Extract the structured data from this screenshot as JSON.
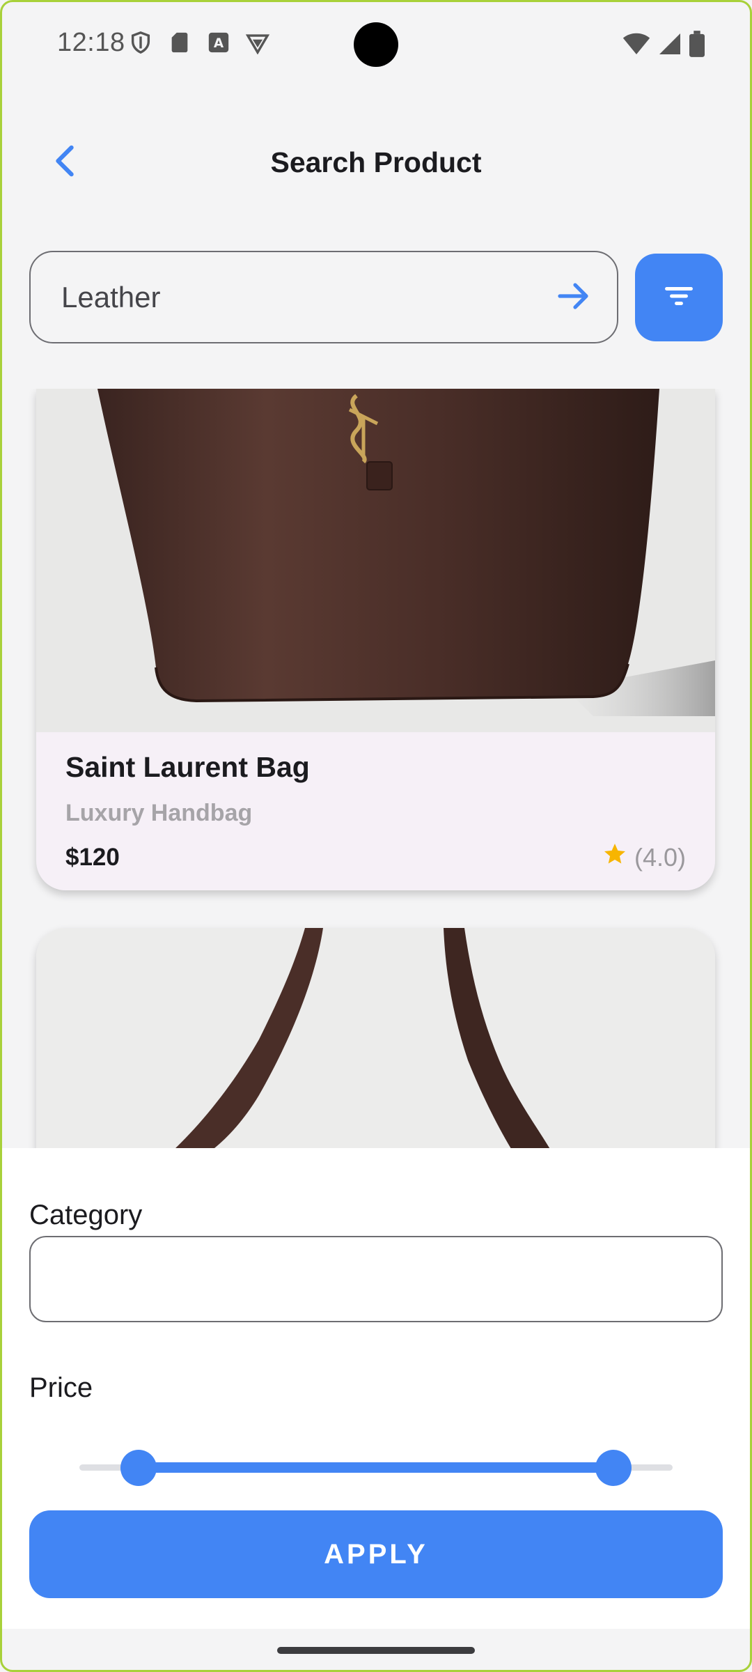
{
  "status_bar": {
    "time": "12:18",
    "left_icons": [
      "shield-icon",
      "sd-card-icon",
      "a-badge-icon",
      "vpn-shield-icon"
    ],
    "right_icons": [
      "wifi-icon",
      "signal-icon",
      "battery-icon"
    ]
  },
  "header": {
    "title": "Search Product",
    "back_icon": "chevron-left-icon"
  },
  "search": {
    "value": "Leather",
    "submit_icon": "arrow-right-icon",
    "filter_icon": "filter-icon"
  },
  "products": [
    {
      "name": "Saint Laurent Bag",
      "subtitle": "Luxury Handbag",
      "price": "$120",
      "rating": "(4.0)",
      "rating_icon": "star-icon"
    },
    {
      "name": "",
      "subtitle": "",
      "price": "",
      "rating": ""
    }
  ],
  "filter_sheet": {
    "category_label": "Category",
    "category_value": "",
    "price_label": "Price",
    "price_range": {
      "low_fraction": 0.1,
      "high_fraction": 0.9
    },
    "apply_label": "APPLY"
  },
  "colors": {
    "accent": "#4285f4",
    "background": "#f4f4f5",
    "card_background": "#f6f0f7",
    "star": "#f7b500",
    "subtitle_gray": "#a6a4a8"
  }
}
